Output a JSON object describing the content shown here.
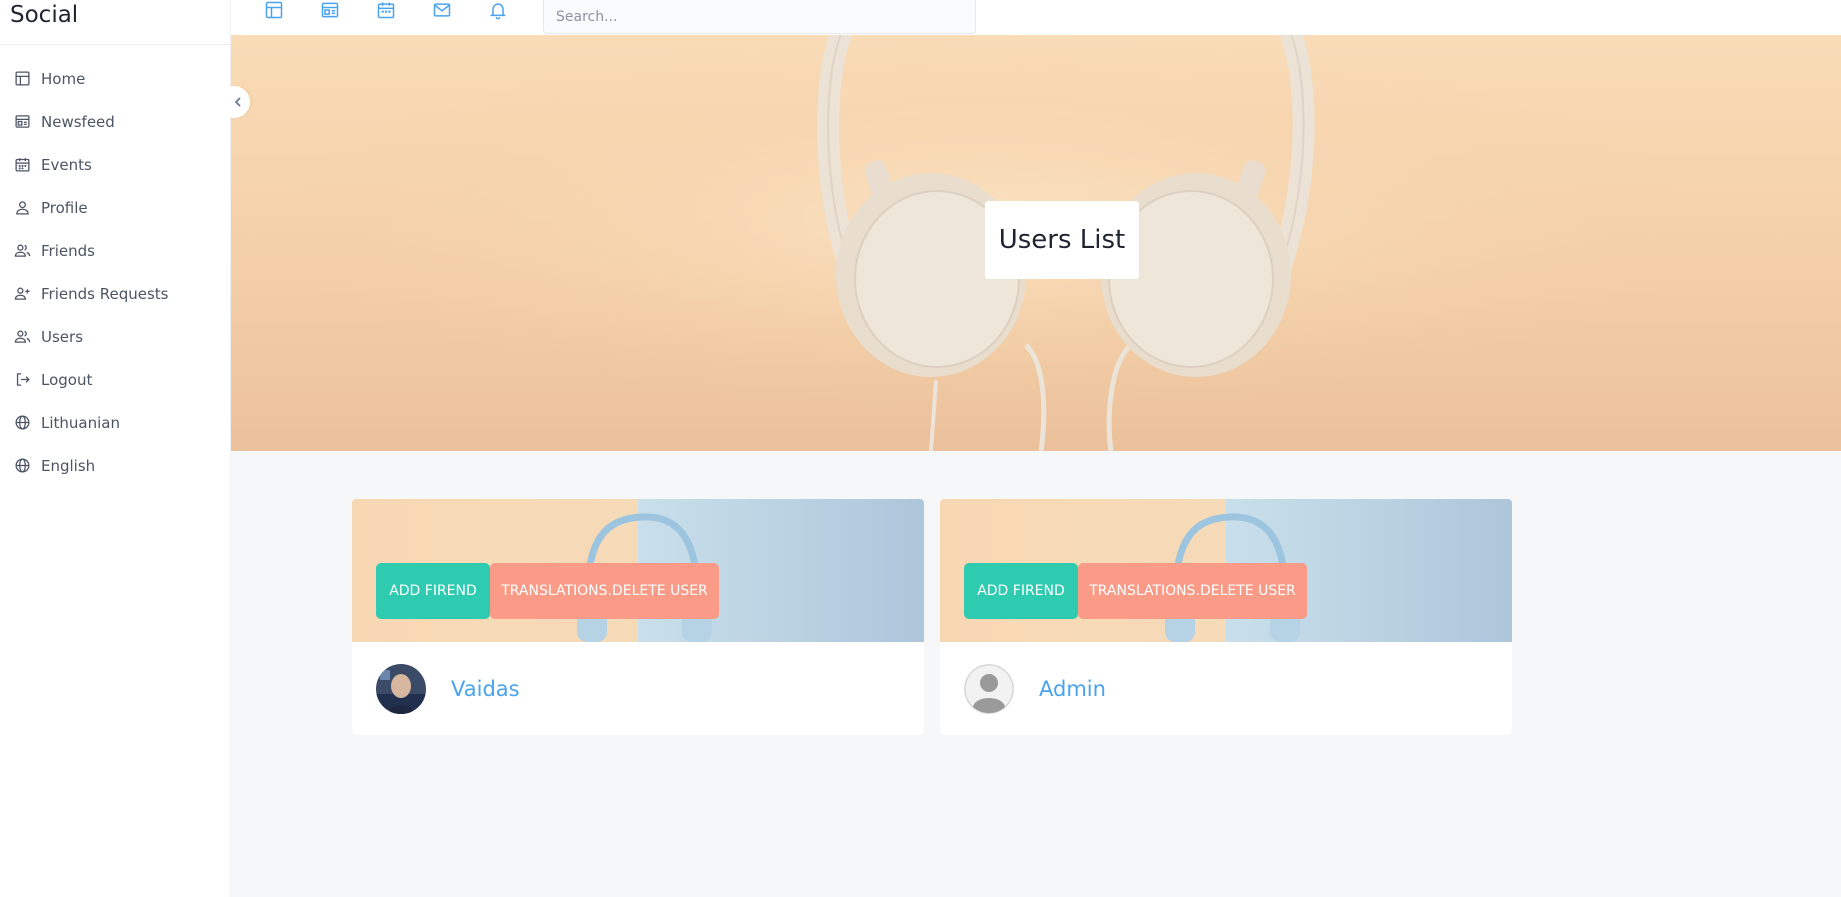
{
  "app": {
    "brand": "Social"
  },
  "sidebar": {
    "items": [
      {
        "label": "Home",
        "icon": "home-icon"
      },
      {
        "label": "Newsfeed",
        "icon": "newsfeed-icon"
      },
      {
        "label": "Events",
        "icon": "calendar-icon"
      },
      {
        "label": "Profile",
        "icon": "user-icon"
      },
      {
        "label": "Friends",
        "icon": "users-icon"
      },
      {
        "label": "Friends Requests",
        "icon": "user-plus-icon"
      },
      {
        "label": "Users",
        "icon": "users-icon"
      },
      {
        "label": "Logout",
        "icon": "logout-icon"
      },
      {
        "label": "Lithuanian",
        "icon": "globe-icon"
      },
      {
        "label": "English",
        "icon": "globe-icon"
      }
    ],
    "collapse_icon": "chevron-left-icon"
  },
  "topbar": {
    "icons": [
      "home-icon",
      "newsfeed-icon",
      "calendar-icon",
      "mail-icon",
      "bell-icon"
    ],
    "search": {
      "placeholder": "Search...",
      "value": ""
    }
  },
  "hero": {
    "title": "Users List"
  },
  "users": [
    {
      "name": "Vaidas",
      "add_label": "ADD FIREND",
      "delete_label": "TRANSLATIONS.DELETE USER",
      "avatar": "photo-avatar"
    },
    {
      "name": "Admin",
      "add_label": "ADD FIREND",
      "delete_label": "TRANSLATIONS.DELETE USER",
      "avatar": "default-avatar"
    }
  ],
  "colors": {
    "accent_blue": "#4aa3ee",
    "add_button": "#2ecbb0",
    "delete_button": "#f99b87",
    "background": "#f6f7f9"
  }
}
